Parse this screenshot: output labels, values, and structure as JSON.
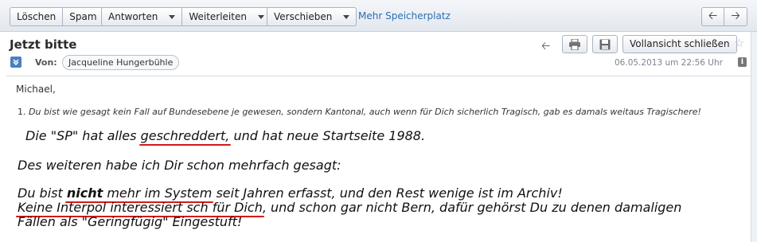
{
  "toolbar": {
    "delete_label": "Löschen",
    "spam_label": "Spam",
    "reply_label": "Antworten",
    "forward_label": "Weiterleiten",
    "move_label": "Verschieben",
    "storage_link": "Mehr Speicherplatz"
  },
  "message": {
    "subject": "Jetzt bitte",
    "fullview_label": "Vollansicht schließen",
    "from_label": "Von:",
    "from_name": "Jacqueline Hungerbühle",
    "date": "06.05.2013 um 22:56 Uhr"
  },
  "body": {
    "greeting": "Michael,",
    "point_number": "1.",
    "point_text": "Du bist wie gesagt  kein Fall auf Bundesebene je gewesen, sondern Kantonal, auch wenn für Dich sicherlich Tragisch, gab es damals weitaus Tragischere!",
    "line1_a": "Die \"SP\" hat alles ",
    "line1_u": "geschreddert,",
    "line1_b": "  und hat neue Startseite 1988.",
    "line2": "Des weiteren habe ich Dir schon mehrfach gesagt:",
    "line3_a": "Du bist ",
    "line3_bold": "nicht",
    "line3_u": " mehr im System",
    "line3_b": " seit Jahren erfasst, und den Rest wenige ist im Archiv!",
    "line4_u": "Keine Interpol interessiert sch für Dich",
    "line4_b": ", und schon gar nicht Bern, dafür gehörst Du zu denen damaligen",
    "line5": "Fällen als \"Geringfügig\" Eingestuft!"
  },
  "colors": {
    "link": "#2a6fb5",
    "underline_annotation": "#d21a1a"
  }
}
